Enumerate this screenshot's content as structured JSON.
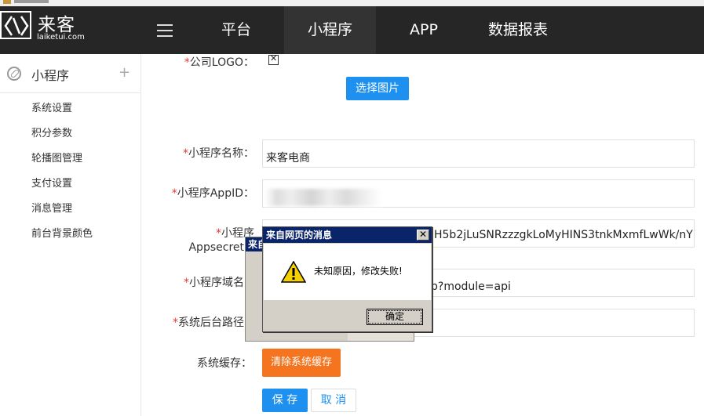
{
  "brand": {
    "name": "来客",
    "url": "laiketui.com"
  },
  "nav": [
    "平台",
    "小程序",
    "APP",
    "数据报表"
  ],
  "sidebar": {
    "title": "小程序",
    "plus": "+",
    "items": [
      "系统设置",
      "积分参数",
      "轮播图管理",
      "支付设置",
      "消息管理",
      "前台背景颜色"
    ]
  },
  "form": {
    "logo_label": "公司LOGO：",
    "choose_image": "选择图片",
    "name_label": "小程序名称：",
    "name_value": "来客电商",
    "appid_label": "小程序AppID：",
    "secret_label_1": "小程序",
    "secret_label_2": "Appsecret",
    "secret_value": "H5b2jLuSNRzzzgkLoMyHINS3tnkMxmfLwWk/nY",
    "domain_label": "小程序域名",
    "domain_value": "p?module=api",
    "backend_label": "系统后台路径",
    "cache_label": "系统缓存：",
    "clear_cache": "清除系统缓存",
    "save": "保 存",
    "cancel": "取 消",
    "required_mark": "*"
  },
  "dialog": {
    "title": "来自网页的消息",
    "message": "未知原因，修改失败!",
    "ok": "确定",
    "close": "✕",
    "bg_title": "来自"
  }
}
